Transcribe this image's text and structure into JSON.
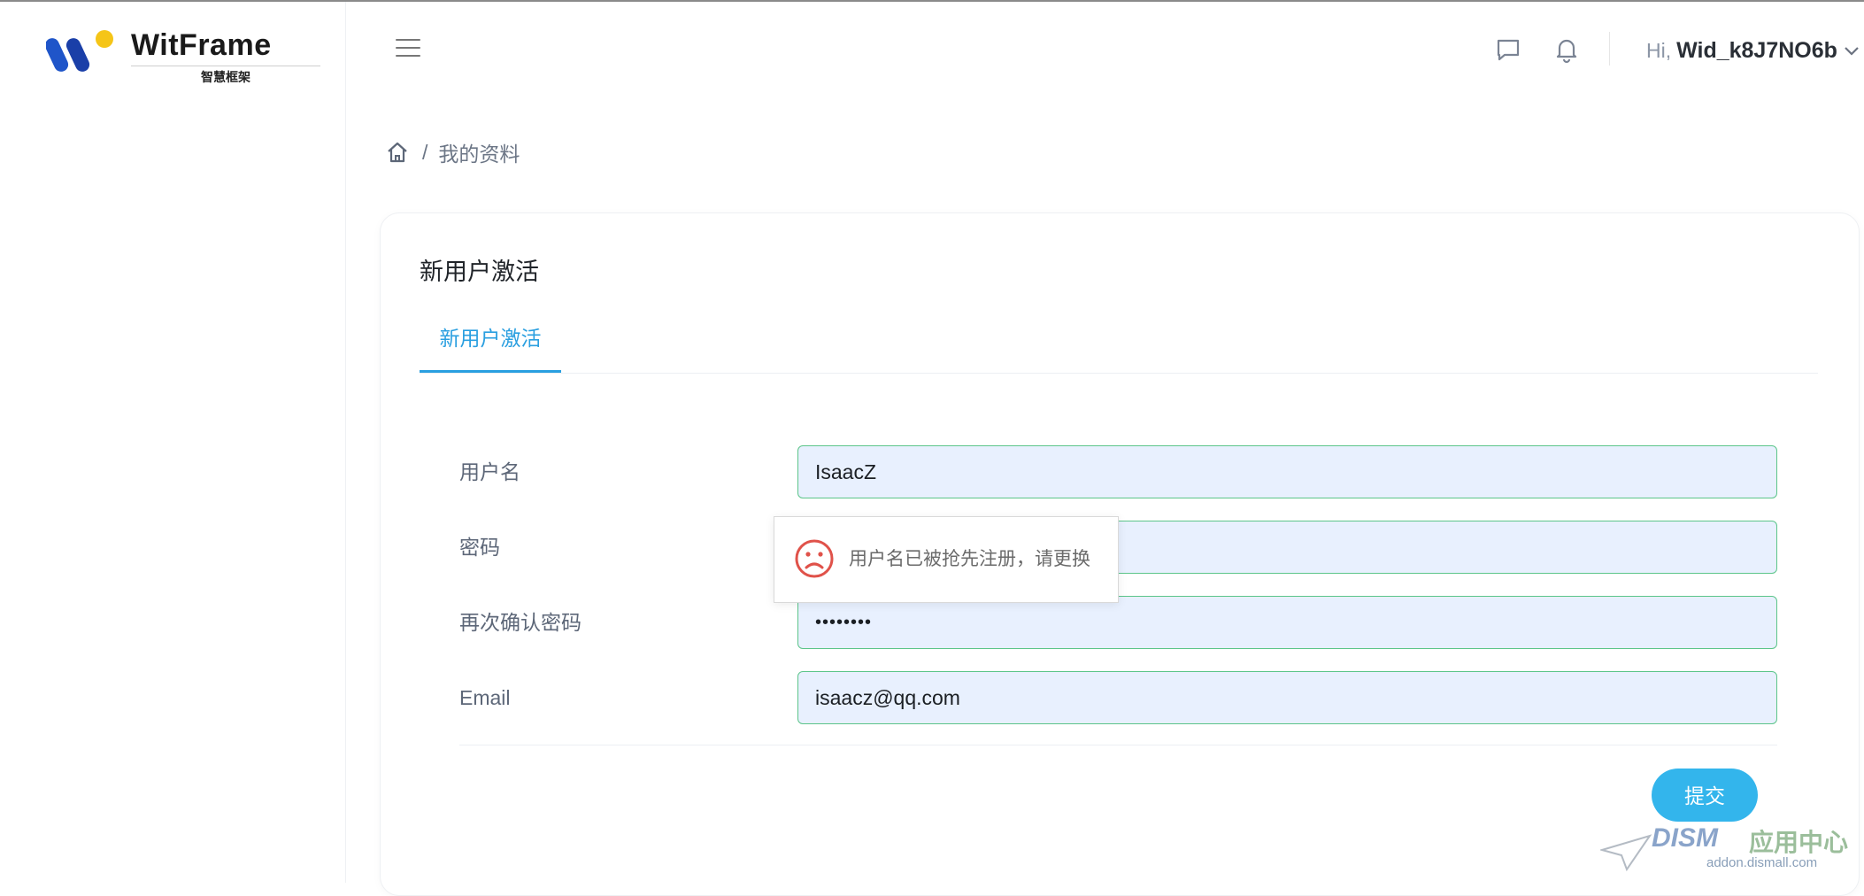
{
  "brand": {
    "name": "WitFrame",
    "subtitle": "智慧框架",
    "colors": {
      "blue": "#1f55c9",
      "yellow": "#f5c518"
    }
  },
  "header": {
    "menu_icon": "hamburger-menu-icon",
    "message_icon": "message-icon",
    "bell_icon": "bell-icon",
    "greeting": "Hi,",
    "username": "Wid_k8J7NO6b"
  },
  "breadcrumb": {
    "home_icon": "home-icon",
    "separator": "/",
    "current": "我的资料"
  },
  "card": {
    "title": "新用户激活",
    "tab_label": "新用户激活"
  },
  "form": {
    "username": {
      "label": "用户名",
      "value": "IsaacZ"
    },
    "password": {
      "label": "密码",
      "value": ""
    },
    "confirm_password": {
      "label": "再次确认密码",
      "value": "••••••••"
    },
    "email": {
      "label": "Email",
      "value": "isaacz@qq.com"
    },
    "submit_label": "提交"
  },
  "toast": {
    "icon": "sad-face-icon",
    "message": "用户名已被抢先注册，请更换"
  },
  "watermark": {
    "text": "DISM",
    "text2": "应用中心",
    "url": "addon.dismall.com"
  },
  "colors": {
    "accent": "#2a9fe0",
    "submit": "#33b5ec",
    "input_border": "#5cc58a",
    "input_bg": "#e8f0fe",
    "error": "#e0524a"
  }
}
